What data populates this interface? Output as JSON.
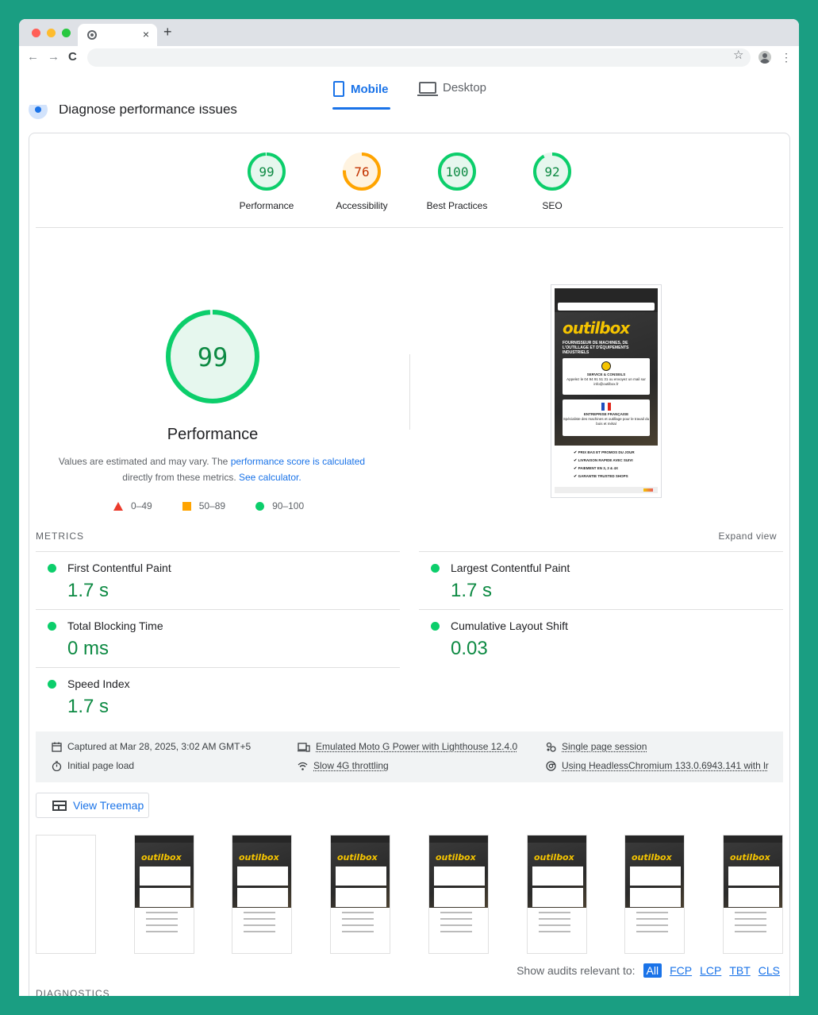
{
  "browser": {
    "tab_close": "×",
    "new_tab": "+",
    "back": "←",
    "forward": "→",
    "reload": "C",
    "star": "☆",
    "menu": "⋮"
  },
  "device_tabs": {
    "mobile": "Mobile",
    "desktop": "Desktop",
    "active": "Mobile"
  },
  "section_title": "Diagnose performance issues",
  "scores": [
    {
      "label": "Performance",
      "value": 99,
      "color": "#0cce6b",
      "track": "#e6f7ee"
    },
    {
      "label": "Accessibility",
      "value": 76,
      "color": "#ffa400",
      "track": "#fff3e0"
    },
    {
      "label": "Best Practices",
      "value": 100,
      "color": "#0cce6b",
      "track": "#e6f7ee"
    },
    {
      "label": "SEO",
      "value": 92,
      "color": "#0cce6b",
      "track": "#e6f7ee"
    }
  ],
  "performance": {
    "score": "99",
    "title": "Performance",
    "desc_prefix": "Values are estimated and may vary. The",
    "desc_link1": "performance score is calculated",
    "desc_mid": "directly from these metrics.",
    "desc_link2": "See calculator."
  },
  "legend": {
    "fail": "0–49",
    "average": "50–89",
    "pass": "90–100"
  },
  "screenshot": {
    "logo": "outilbox",
    "hero_text": "FOURNISSEUR DE MACHINES, DE L'OUTILLAGE ET D'ÉQUIPEMENTS INDUSTRIELS",
    "box1_title": "SERVICE & CONSEILS",
    "box1_line": "Appelez le 04 94 91 51 31 ou envoyez un mail sur info@outilbox.fr",
    "box2_title": "ENTREPRISE FRANÇAISE",
    "box2_line": "Spécialiste des machines et outillage pour le travail du bois et métal",
    "list": [
      "PRIX BAS ET PROMOS DU JOUR",
      "LIVRAISON RAPIDE AVEC SUIVI",
      "PAIEMENT EN 3, 3 & 4X",
      "GARANTIE TRUSTED SHOPS"
    ]
  },
  "metrics": {
    "header": "METRICS",
    "expand": "Expand view",
    "items": [
      {
        "name": "First Contentful Paint",
        "value": "1.7 s"
      },
      {
        "name": "Largest Contentful Paint",
        "value": "1.7 s"
      },
      {
        "name": "Total Blocking Time",
        "value": "0 ms"
      },
      {
        "name": "Cumulative Layout Shift",
        "value": "0.03"
      },
      {
        "name": "Speed Index",
        "value": "1.7 s"
      }
    ]
  },
  "runtime": {
    "captured": "Captured at Mar 28, 2025, 3:02 AM GMT+5",
    "load": "Initial page load",
    "device": "Emulated Moto G Power with Lighthouse 12.4.0",
    "throttle": "Slow 4G throttling",
    "session": "Single page session",
    "browser": "Using HeadlessChromium 133.0.6943.141 with lr"
  },
  "treemap_label": "View Treemap",
  "filmstrip_frames": 8,
  "filter": {
    "label": "Show audits relevant to:",
    "chips": [
      "All",
      "FCP",
      "LCP",
      "TBT",
      "CLS"
    ],
    "active": "All"
  },
  "diagnostics_header": "DIAGNOSTICS"
}
